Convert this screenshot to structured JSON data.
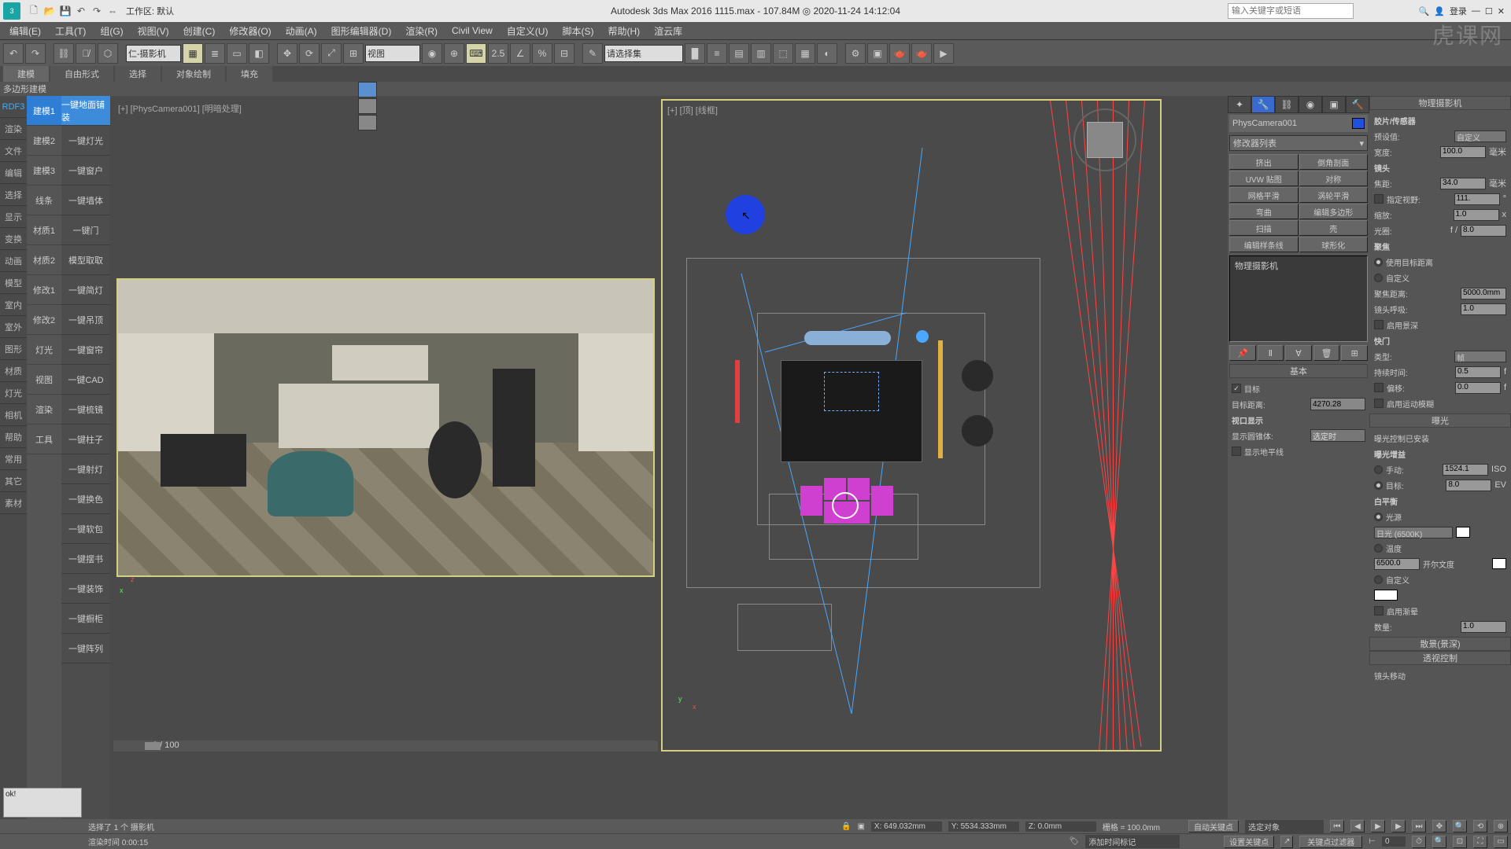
{
  "title": "Autodesk 3ds Max 2016    1115.max - 107.84M ◎ 2020-11-24 14:12:04",
  "workspace": "工作区: 默认",
  "search_placeholder": "输入关键字或短语",
  "login": "登录",
  "menu": [
    "编辑(E)",
    "工具(T)",
    "组(G)",
    "视图(V)",
    "创建(C)",
    "修改器(O)",
    "动画(A)",
    "图形编辑器(D)",
    "渲染(R)",
    "Civil View",
    "自定义(U)",
    "脚本(S)",
    "帮助(H)",
    "渲云库"
  ],
  "toolbar_dd1": "仁-摄影机",
  "toolbar_dd2": "视图",
  "toolbar_dd3": "请选择集",
  "tabs": [
    "建模",
    "自由形式",
    "选择",
    "对象绘制",
    "填充"
  ],
  "subtab": "多边形建模",
  "side1": [
    "RDF3",
    "渲染",
    "文件",
    "编辑",
    "选择",
    "显示",
    "变换",
    "动画",
    "模型",
    "室内",
    "室外",
    "图形",
    "材质",
    "灯光",
    "相机",
    "帮助",
    "常用",
    "其它",
    "素材"
  ],
  "side2": [
    "建模1",
    "建模2",
    "建模3",
    "线条",
    "材质1",
    "材质2",
    "修改1",
    "修改2",
    "灯光",
    "视图",
    "渲染",
    "工具"
  ],
  "side3": [
    "一键地面铺装",
    "一键灯光",
    "一键窗户",
    "一键墙体",
    "一键门",
    "模型取取",
    "一键简灯",
    "一键吊顶",
    "一键窗帘",
    "一键CAD",
    "一键梳镜",
    "一键柱子",
    "一键射灯",
    "一键换色",
    "一键软包",
    "一键摆书",
    "一键装饰",
    "一键橱柜",
    "一键阵列"
  ],
  "vp_left_label": "[+] [PhysCamera001] [明暗处理]",
  "vp_right_label": "[+] [顶] [线框]",
  "cmd": {
    "name": "PhysCamera001",
    "modlist": "修改器列表",
    "btns": [
      "挤出",
      "倒角剖面",
      "UVW 贴图",
      "对称",
      "网格平滑",
      "涡轮平滑",
      "弯曲",
      "编辑多边形",
      "扫描",
      "壳",
      "编辑样条线",
      "球形化"
    ],
    "stack_item": "物理摄影机",
    "roll_basic": "基本",
    "target": "目标",
    "target_dist_label": "目标距离:",
    "target_dist": "4270.28",
    "vp_display": "视口显示",
    "show_cone_label": "显示圆锥体:",
    "show_cone": "选定时",
    "show_horizon": "显示地平线"
  },
  "phy": {
    "head1": "物理摄影机",
    "sec_film": "胶片/传感器",
    "preset_l": "预设值:",
    "preset": "自定义",
    "width_l": "宽度:",
    "width": "100.0",
    "sec_lens": "镜头",
    "focal_l": "焦距:",
    "focal": "34.0",
    "fov_l": "指定视野:",
    "fov": "111.",
    "zoom_l": "缩放:",
    "zoom": "1.0",
    "aperture_l": "光圈:",
    "aperture_pre": "f /",
    "aperture": "8.0",
    "sec_focus": "聚焦",
    "focus_opt1": "使用目标距离",
    "focus_opt2": "自定义",
    "focus_dist_l": "聚焦距离:",
    "focus_dist": "5000.0mm",
    "lens_breath_l": "镜头呼吸:",
    "lens_breath": "1.0",
    "dof_chk": "启用景深",
    "sec_shutter": "快门",
    "shutter_type_l": "类型:",
    "shutter_type": "帧",
    "duration_l": "持续时间:",
    "duration": "0.5",
    "offset_l": "偏移:",
    "offset": "0.0",
    "motion_blur": "启用运动模糊",
    "head2": "曝光",
    "exp_install": "曝光控制已安装",
    "exp_gain": "曝光增益",
    "manual_l": "手动:",
    "manual": "1524.1",
    "manual_unit": "ISO",
    "target_l": "目标:",
    "target": "8.0",
    "target_unit": "EV",
    "wb": "白平衡",
    "wb_source": "光源",
    "wb_preset": "日光 (6500K)",
    "wb_temp": "温度",
    "wb_temp_val": "6500.0",
    "wb_temp_unit": "开尔文度",
    "wb_custom": "自定义",
    "vignette": "启用渐晕",
    "vignette_amt_l": "数量:",
    "vignette_amt": "1.0",
    "head3": "散景(景深)",
    "head4": "透视控制",
    "lens_shift": "镜头移动"
  },
  "status": {
    "sel": "选择了 1 个 摄影机",
    "x": "X: 649.032mm",
    "y": "Y: 5534.333mm",
    "z": "Z: 0.0mm",
    "grid": "栅格 = 100.0mm",
    "autokey": "自动关键点",
    "selset": "选定对象",
    "ok": "ok!",
    "rtime": "渲染时间  0:00:15",
    "addtag": "添加时间标记",
    "setkey": "设置关键点",
    "keyfilter": "关键点过滤器",
    "frame": "0",
    "timeslider": "0 / 100"
  },
  "watermark": "虎课网"
}
